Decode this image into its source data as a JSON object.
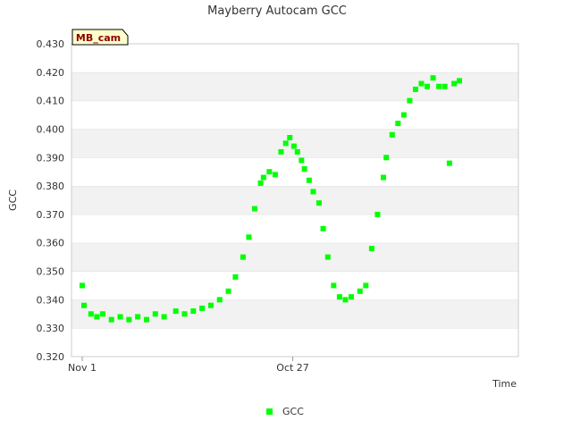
{
  "chart_data": {
    "type": "scatter",
    "title": "Mayberry Autocam GCC",
    "xlabel": "Time",
    "ylabel": "GCC",
    "ylim": [
      0.32,
      0.43
    ],
    "yticks": [
      "0.320",
      "0.330",
      "0.340",
      "0.350",
      "0.360",
      "0.370",
      "0.380",
      "0.390",
      "0.400",
      "0.410",
      "0.420",
      "0.430"
    ],
    "xticks": [
      {
        "label": "Nov 1",
        "day": 0
      },
      {
        "label": "Oct 27",
        "day": 360
      }
    ],
    "xlim_days": [
      0,
      700
    ],
    "grid": "alternating horizontal bands",
    "legend": "bottom-center",
    "badge": "MB_cam",
    "series": [
      {
        "name": "GCC",
        "color": "#00ff00",
        "marker": "square",
        "x": [
          0,
          3,
          15,
          25,
          35,
          50,
          65,
          80,
          95,
          110,
          125,
          140,
          160,
          175,
          190,
          205,
          220,
          235,
          250,
          262,
          275,
          285,
          295,
          305,
          310,
          320,
          330,
          340,
          348,
          355,
          362,
          368,
          375,
          380,
          388,
          395,
          405,
          412,
          420,
          430,
          440,
          450,
          460,
          475,
          485,
          495,
          505,
          515,
          520,
          530,
          540,
          550,
          560,
          570,
          580,
          590,
          600,
          610,
          620,
          628,
          636,
          645
        ],
        "y": [
          0.345,
          0.338,
          0.335,
          0.334,
          0.335,
          0.333,
          0.334,
          0.333,
          0.334,
          0.333,
          0.335,
          0.334,
          0.336,
          0.335,
          0.336,
          0.337,
          0.338,
          0.34,
          0.343,
          0.348,
          0.355,
          0.362,
          0.372,
          0.381,
          0.383,
          0.385,
          0.384,
          0.392,
          0.395,
          0.397,
          0.394,
          0.392,
          0.389,
          0.386,
          0.382,
          0.378,
          0.374,
          0.365,
          0.355,
          0.345,
          0.341,
          0.34,
          0.341,
          0.343,
          0.345,
          0.358,
          0.37,
          0.383,
          0.39,
          0.398,
          0.402,
          0.405,
          0.41,
          0.414,
          0.416,
          0.415,
          0.418,
          0.415,
          0.415,
          0.388,
          0.416,
          0.417
        ]
      }
    ]
  }
}
